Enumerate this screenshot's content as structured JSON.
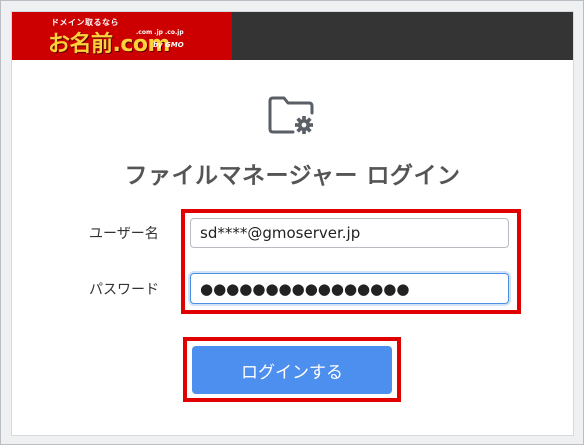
{
  "header": {
    "logo_tagline": "ドメイン取るなら",
    "logo_name": "お名前.com",
    "logo_domains": ".com .jp .co.jp",
    "logo_gmo": "by GMO"
  },
  "icons": {
    "folder": "folder-settings-icon"
  },
  "colors": {
    "header_bg": "#343434",
    "logo_bg": "#cc0000",
    "button_bg": "#4d8fee",
    "highlight": "#e00000"
  },
  "form": {
    "title": "ファイルマネージャー ログイン",
    "username_label": "ユーザー名",
    "username_value": "sd****@gmoserver.jp",
    "password_label": "パスワード",
    "password_value": "●●●●●●●●●●●●●●●●",
    "submit_label": "ログインする"
  }
}
